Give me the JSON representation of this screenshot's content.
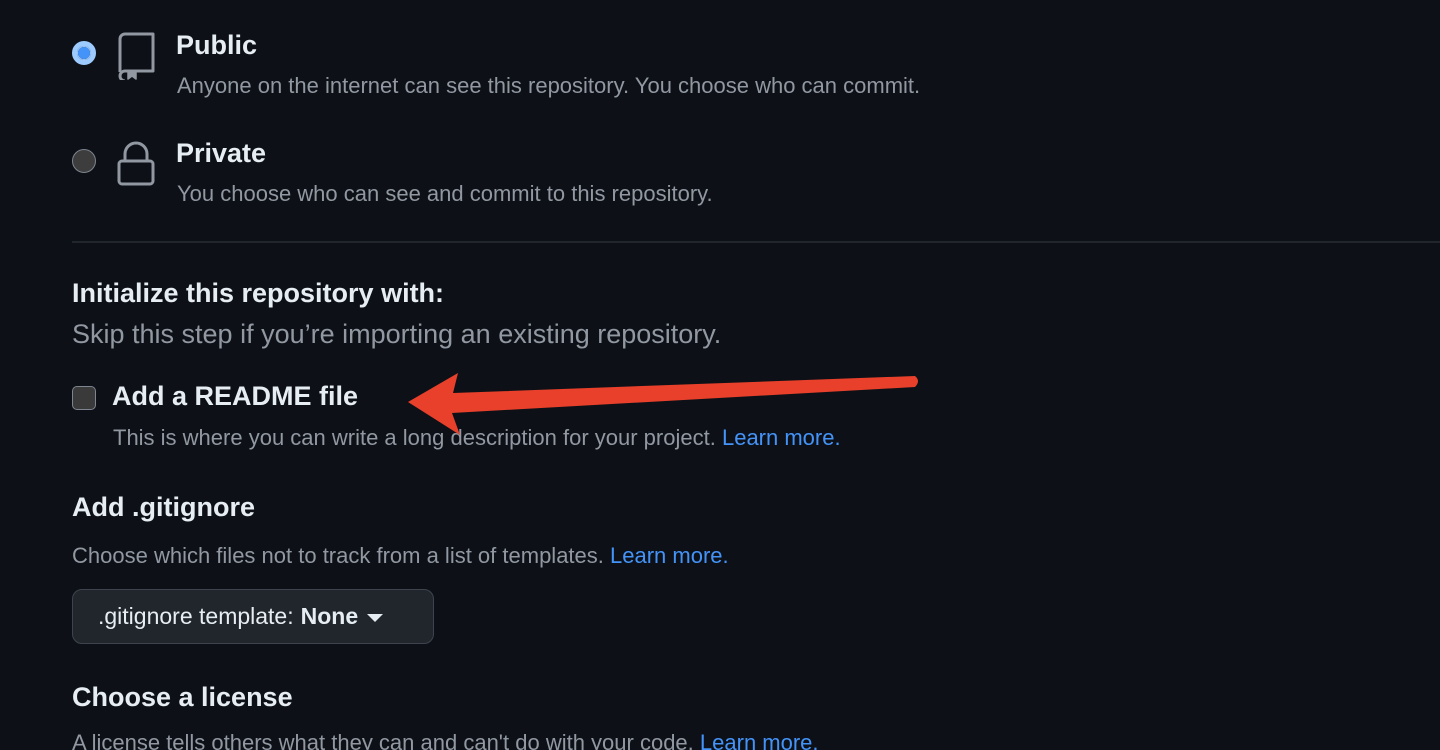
{
  "visibility": {
    "public": {
      "title": "Public",
      "description": "Anyone on the internet can see this repository. You choose who can commit.",
      "selected": true,
      "icon": "repo-icon"
    },
    "private": {
      "title": "Private",
      "description": "You choose who can see and commit to this repository.",
      "selected": false,
      "icon": "lock-icon"
    }
  },
  "initialize": {
    "title": "Initialize this repository with:",
    "subtitle": "Skip this step if you’re importing an existing repository.",
    "readme": {
      "label": "Add a README file",
      "description": "This is where you can write a long description for your project.",
      "link": "Learn more.",
      "checked": false
    }
  },
  "gitignore": {
    "title": "Add .gitignore",
    "description": "Choose which files not to track from a list of templates.",
    "link": "Learn more.",
    "select_label": ".gitignore template:",
    "select_value": "None"
  },
  "license": {
    "title": "Choose a license",
    "description": "A license tells others what they can and can't do with your code.",
    "link": "Learn more."
  },
  "annotation": {
    "arrow_color": "#e8402b"
  },
  "colors": {
    "background": "#0d1117",
    "link": "#4493f8",
    "muted_text": "#9198a1"
  }
}
